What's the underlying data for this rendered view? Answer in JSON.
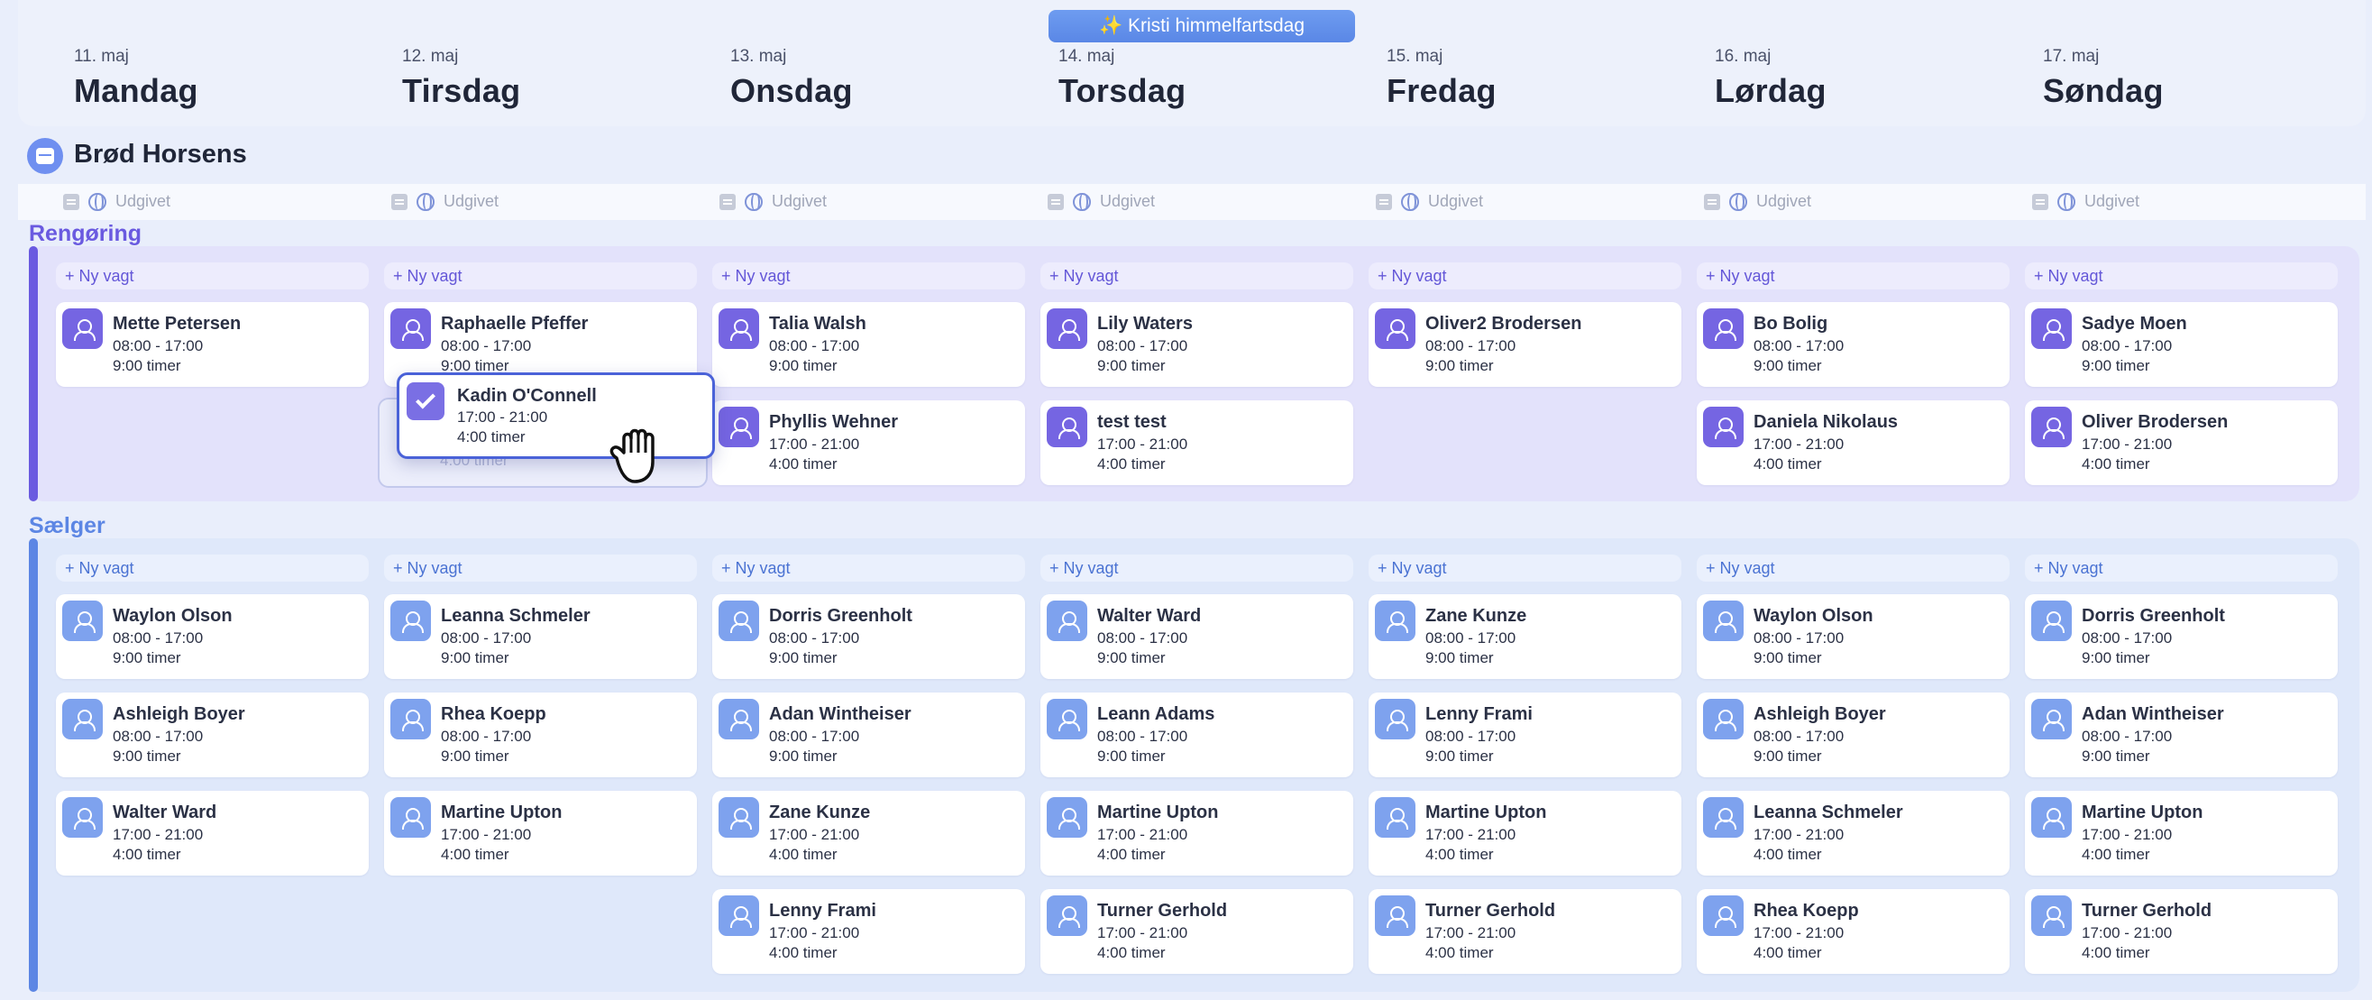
{
  "holiday": {
    "icon": "sparkles-icon",
    "label": "✨ Kristi himmelfartsdag"
  },
  "days": [
    {
      "date": "11. maj",
      "name": "Mandag"
    },
    {
      "date": "12. maj",
      "name": "Tirsdag"
    },
    {
      "date": "13. maj",
      "name": "Onsdag"
    },
    {
      "date": "14. maj",
      "name": "Torsdag"
    },
    {
      "date": "15. maj",
      "name": "Fredag"
    },
    {
      "date": "16. maj",
      "name": "Lørdag"
    },
    {
      "date": "17. maj",
      "name": "Søndag"
    }
  ],
  "location": {
    "name": "Brød Horsens",
    "icon": "store-icon"
  },
  "published_label": "Udgivet",
  "new_shift_label": "+ Ny vagt",
  "colors": {
    "rengoering": "#6a5ae0",
    "saelger": "#5c86e4",
    "drag_border": "#4a62d8"
  },
  "groups": [
    {
      "label": "Rengøring",
      "shifts": [
        [
          {
            "name": "Mette Petersen",
            "time": "08:00 - 17:00",
            "hours": "9:00 timer"
          }
        ],
        [
          {
            "name": "Raphaelle Pfeffer",
            "time": "08:00 - 17:00",
            "hours": "9:00 timer"
          }
        ],
        [
          {
            "name": "Talia Walsh",
            "time": "08:00 - 17:00",
            "hours": "9:00 timer"
          },
          {
            "name": "Phyllis Wehner",
            "time": "17:00 - 21:00",
            "hours": "4:00 timer"
          }
        ],
        [
          {
            "name": "Lily Waters",
            "time": "08:00 - 17:00",
            "hours": "9:00 timer"
          },
          {
            "name": "test test",
            "time": "17:00 - 21:00",
            "hours": "4:00 timer"
          }
        ],
        [
          {
            "name": "Oliver2 Brodersen",
            "time": "08:00 - 17:00",
            "hours": "9:00 timer"
          }
        ],
        [
          {
            "name": "Bo Bolig",
            "time": "08:00 - 17:00",
            "hours": "9:00 timer"
          },
          {
            "name": "Daniela Nikolaus",
            "time": "17:00 - 21:00",
            "hours": "4:00 timer"
          }
        ],
        [
          {
            "name": "Sadye Moen",
            "time": "08:00 - 17:00",
            "hours": "9:00 timer"
          },
          {
            "name": "Oliver Brodersen",
            "time": "17:00 - 21:00",
            "hours": "4:00 timer"
          }
        ]
      ]
    },
    {
      "label": "Sælger",
      "shifts": [
        [
          {
            "name": "Waylon Olson",
            "time": "08:00 - 17:00",
            "hours": "9:00 timer"
          },
          {
            "name": "Ashleigh Boyer",
            "time": "08:00 - 17:00",
            "hours": "9:00 timer"
          },
          {
            "name": "Walter Ward",
            "time": "17:00 - 21:00",
            "hours": "4:00 timer"
          }
        ],
        [
          {
            "name": "Leanna Schmeler",
            "time": "08:00 - 17:00",
            "hours": "9:00 timer"
          },
          {
            "name": "Rhea Koepp",
            "time": "08:00 - 17:00",
            "hours": "9:00 timer"
          },
          {
            "name": "Martine Upton",
            "time": "17:00 - 21:00",
            "hours": "4:00 timer"
          }
        ],
        [
          {
            "name": "Dorris Greenholt",
            "time": "08:00 - 17:00",
            "hours": "9:00 timer"
          },
          {
            "name": "Adan Wintheiser",
            "time": "08:00 - 17:00",
            "hours": "9:00 timer"
          },
          {
            "name": "Zane Kunze",
            "time": "17:00 - 21:00",
            "hours": "4:00 timer"
          },
          {
            "name": "Lenny Frami",
            "time": "17:00 - 21:00",
            "hours": "4:00 timer"
          }
        ],
        [
          {
            "name": "Walter Ward",
            "time": "08:00 - 17:00",
            "hours": "9:00 timer"
          },
          {
            "name": "Leann Adams",
            "time": "08:00 - 17:00",
            "hours": "9:00 timer"
          },
          {
            "name": "Martine Upton",
            "time": "17:00 - 21:00",
            "hours": "4:00 timer"
          },
          {
            "name": "Turner Gerhold",
            "time": "17:00 - 21:00",
            "hours": "4:00 timer"
          }
        ],
        [
          {
            "name": "Zane Kunze",
            "time": "08:00 - 17:00",
            "hours": "9:00 timer"
          },
          {
            "name": "Lenny Frami",
            "time": "08:00 - 17:00",
            "hours": "9:00 timer"
          },
          {
            "name": "Martine Upton",
            "time": "17:00 - 21:00",
            "hours": "4:00 timer"
          },
          {
            "name": "Turner Gerhold",
            "time": "17:00 - 21:00",
            "hours": "4:00 timer"
          }
        ],
        [
          {
            "name": "Waylon Olson",
            "time": "08:00 - 17:00",
            "hours": "9:00 timer"
          },
          {
            "name": "Ashleigh Boyer",
            "time": "08:00 - 17:00",
            "hours": "9:00 timer"
          },
          {
            "name": "Leanna Schmeler",
            "time": "17:00 - 21:00",
            "hours": "4:00 timer"
          },
          {
            "name": "Rhea Koepp",
            "time": "17:00 - 21:00",
            "hours": "4:00 timer"
          }
        ],
        [
          {
            "name": "Dorris Greenholt",
            "time": "08:00 - 17:00",
            "hours": "9:00 timer"
          },
          {
            "name": "Adan Wintheiser",
            "time": "08:00 - 17:00",
            "hours": "9:00 timer"
          },
          {
            "name": "Martine Upton",
            "time": "17:00 - 21:00",
            "hours": "4:00 timer"
          },
          {
            "name": "Turner Gerhold",
            "time": "17:00 - 21:00",
            "hours": "4:00 timer"
          }
        ]
      ]
    }
  ],
  "dragging": {
    "name": "Kadin O'Connell",
    "time": "17:00 - 21:00",
    "hours": "4:00 timer",
    "ghost_hours": "4:00 timer",
    "cursor": "grab-hand-icon"
  }
}
